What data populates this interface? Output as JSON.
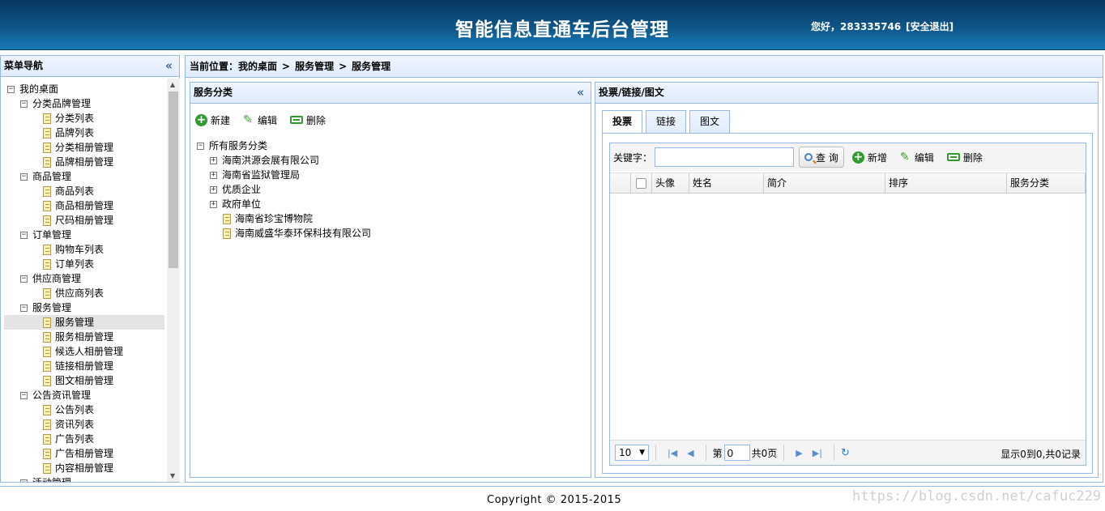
{
  "header": {
    "title": "智能信息直通车后台管理",
    "greeting": "您好，283335746",
    "logout": "[安全退出]"
  },
  "sidebar": {
    "title": "菜单导航",
    "collapse_icon": "double-chevron-left-icon",
    "items": [
      {
        "label": "我的桌面",
        "level": 0,
        "kind": "folder"
      },
      {
        "label": "分类品牌管理",
        "level": 1,
        "kind": "folder"
      },
      {
        "label": "分类列表",
        "level": 2,
        "kind": "leaf"
      },
      {
        "label": "品牌列表",
        "level": 2,
        "kind": "leaf"
      },
      {
        "label": "分类相册管理",
        "level": 2,
        "kind": "leaf"
      },
      {
        "label": "品牌相册管理",
        "level": 2,
        "kind": "leaf"
      },
      {
        "label": "商品管理",
        "level": 1,
        "kind": "folder"
      },
      {
        "label": "商品列表",
        "level": 2,
        "kind": "leaf"
      },
      {
        "label": "商品相册管理",
        "level": 2,
        "kind": "leaf"
      },
      {
        "label": "尺码相册管理",
        "level": 2,
        "kind": "leaf"
      },
      {
        "label": "订单管理",
        "level": 1,
        "kind": "folder"
      },
      {
        "label": "购物车列表",
        "level": 2,
        "kind": "leaf"
      },
      {
        "label": "订单列表",
        "level": 2,
        "kind": "leaf"
      },
      {
        "label": "供应商管理",
        "level": 1,
        "kind": "folder"
      },
      {
        "label": "供应商列表",
        "level": 2,
        "kind": "leaf"
      },
      {
        "label": "服务管理",
        "level": 1,
        "kind": "folder"
      },
      {
        "label": "服务管理",
        "level": 2,
        "kind": "leaf",
        "selected": true
      },
      {
        "label": "服务相册管理",
        "level": 2,
        "kind": "leaf"
      },
      {
        "label": "候选人相册管理",
        "level": 2,
        "kind": "leaf"
      },
      {
        "label": "链接相册管理",
        "level": 2,
        "kind": "leaf"
      },
      {
        "label": "图文相册管理",
        "level": 2,
        "kind": "leaf"
      },
      {
        "label": "公告资讯管理",
        "level": 1,
        "kind": "folder"
      },
      {
        "label": "公告列表",
        "level": 2,
        "kind": "leaf"
      },
      {
        "label": "资讯列表",
        "level": 2,
        "kind": "leaf"
      },
      {
        "label": "广告列表",
        "level": 2,
        "kind": "leaf"
      },
      {
        "label": "广告相册管理",
        "level": 2,
        "kind": "leaf"
      },
      {
        "label": "内容相册管理",
        "level": 2,
        "kind": "leaf"
      },
      {
        "label": "活动管理",
        "level": 1,
        "kind": "folder"
      }
    ]
  },
  "breadcrumb": {
    "prefix": "当前位置：",
    "items": [
      "我的桌面",
      "服务管理",
      "服务管理"
    ],
    "separator": ">"
  },
  "category_panel": {
    "title": "服务分类",
    "collapse_icon": "double-chevron-left-icon",
    "toolbar": {
      "new": "新建",
      "edit": "编辑",
      "delete": "删除"
    },
    "tree": [
      {
        "label": "所有服务分类",
        "level": 0,
        "kind": "folder"
      },
      {
        "label": "海南洪源会展有限公司",
        "level": 1,
        "kind": "folder-collapsed"
      },
      {
        "label": "海南省监狱管理局",
        "level": 1,
        "kind": "folder-collapsed"
      },
      {
        "label": "优质企业",
        "level": 1,
        "kind": "folder-collapsed"
      },
      {
        "label": "政府单位",
        "level": 1,
        "kind": "folder-collapsed"
      },
      {
        "label": "海南省珍宝博物院",
        "level": 2,
        "kind": "leaf"
      },
      {
        "label": "海南威盛华泰环保科技有限公司",
        "level": 2,
        "kind": "leaf"
      }
    ]
  },
  "right_panel": {
    "title": "投票/链接/图文",
    "tabs": [
      {
        "label": "投票",
        "active": true
      },
      {
        "label": "链接"
      },
      {
        "label": "图文"
      }
    ],
    "search": {
      "label": "关键字：",
      "value": "",
      "button": "查 询"
    },
    "toolbar": {
      "add": "新增",
      "edit": "编辑",
      "delete": "删除"
    },
    "columns": [
      "头像",
      "姓名",
      "简介",
      "排序",
      "服务分类"
    ],
    "pager": {
      "page_size": "10",
      "page_label": "第",
      "page_value": "0",
      "total_pages": "共0页",
      "info": "显示0到0,共0记录"
    }
  },
  "footer": {
    "copyright": "Copyright © 2015-2015",
    "watermark": "https://blog.csdn.net/cafuc229"
  }
}
